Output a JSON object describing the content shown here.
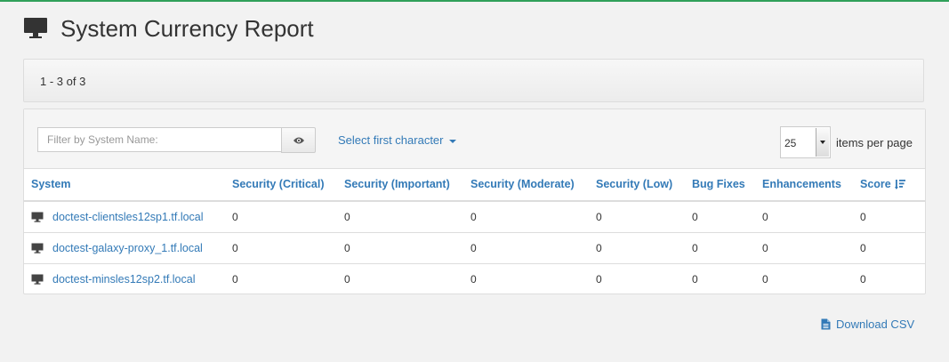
{
  "page": {
    "title": "System Currency Report"
  },
  "pager": {
    "range_text": "1 - 3 of 3"
  },
  "filter": {
    "placeholder": "Filter by System Name:"
  },
  "char_select": {
    "label": "Select first character"
  },
  "per_page": {
    "value": "25",
    "label": "items per page"
  },
  "table": {
    "headers": {
      "system": "System",
      "sec_critical": "Security (Critical)",
      "sec_important": "Security (Important)",
      "sec_moderate": "Security (Moderate)",
      "sec_low": "Security (Low)",
      "bug_fixes": "Bug Fixes",
      "enhancements": "Enhancements",
      "score": "Score"
    },
    "rows": [
      {
        "system": "doctest-clientsles12sp1.tf.local",
        "sec_critical": "0",
        "sec_important": "0",
        "sec_moderate": "0",
        "sec_low": "0",
        "bug_fixes": "0",
        "enhancements": "0",
        "score": "0"
      },
      {
        "system": "doctest-galaxy-proxy_1.tf.local",
        "sec_critical": "0",
        "sec_important": "0",
        "sec_moderate": "0",
        "sec_low": "0",
        "bug_fixes": "0",
        "enhancements": "0",
        "score": "0"
      },
      {
        "system": "doctest-minsles12sp2.tf.local",
        "sec_critical": "0",
        "sec_important": "0",
        "sec_moderate": "0",
        "sec_low": "0",
        "bug_fixes": "0",
        "enhancements": "0",
        "score": "0"
      }
    ]
  },
  "download": {
    "label": "Download CSV"
  },
  "colors": {
    "accent": "#337ab7",
    "topline": "#30a05a",
    "background": "#f2f2f2"
  }
}
